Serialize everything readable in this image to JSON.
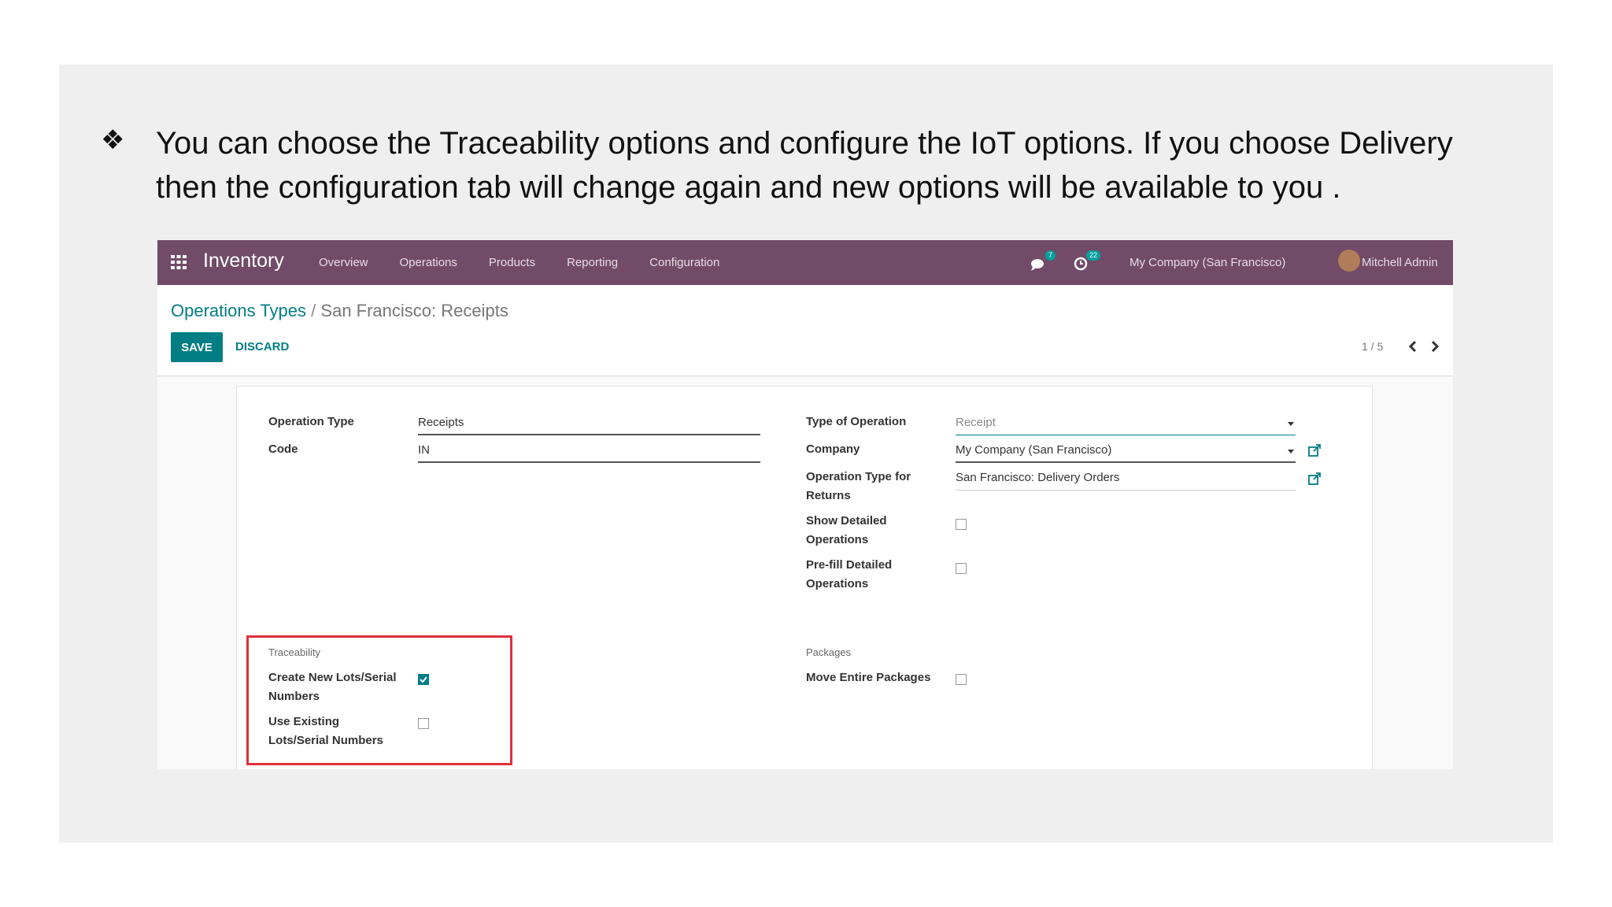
{
  "slide": {
    "bullet": "❖",
    "text": "You can choose the Traceability options and configure the IoT options.  If you choose Delivery then the configuration tab will change again and new options will be available to you ."
  },
  "navbar": {
    "app_title": "Inventory",
    "menu": [
      "Overview",
      "Operations",
      "Products",
      "Reporting",
      "Configuration"
    ],
    "messages_badge": "7",
    "activities_badge": "22",
    "company": "My Company (San Francisco)",
    "user": "Mitchell Admin",
    "color": "#714b67"
  },
  "control_panel": {
    "breadcrumb_parent": "Operations Types",
    "breadcrumb_sep": "/",
    "breadcrumb_current": "San Francisco: Receipts",
    "save_label": "SAVE",
    "discard_label": "DISCARD",
    "pager": "1 / 5",
    "accent": "#017e84"
  },
  "form": {
    "operation_type_label": "Operation Type",
    "operation_type_value": "Receipts",
    "code_label": "Code",
    "code_value": "IN",
    "type_of_operation_label": "Type of Operation",
    "type_of_operation_value": "Receipt",
    "company_label": "Company",
    "company_value": "My Company (San Francisco)",
    "return_type_label_1": "Operation Type for",
    "return_type_label_2": "Returns",
    "return_type_value": "San Francisco: Delivery Orders",
    "show_detailed_label_1": "Show Detailed",
    "show_detailed_label_2": "Operations",
    "show_detailed_checked": false,
    "prefill_label_1": "Pre-fill Detailed",
    "prefill_label_2": "Operations",
    "prefill_checked": false,
    "traceability_title": "Traceability",
    "create_lots_label_1": "Create New Lots/Serial",
    "create_lots_label_2": "Numbers",
    "create_lots_checked": true,
    "use_existing_label_1": "Use Existing",
    "use_existing_label_2": "Lots/Serial Numbers",
    "use_existing_checked": false,
    "packages_title": "Packages",
    "move_packages_label": "Move Entire Packages",
    "move_packages_checked": false,
    "highlight_color": "#e0303b"
  }
}
